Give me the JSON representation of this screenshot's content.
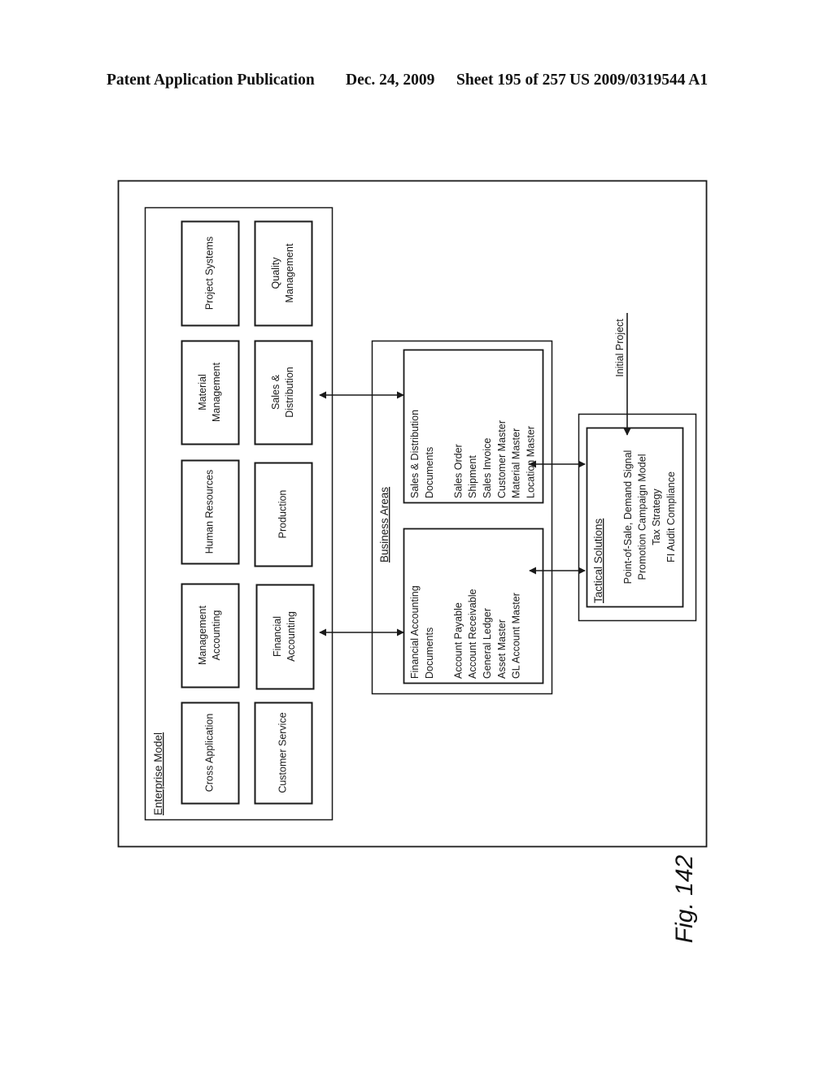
{
  "header": {
    "publication": "Patent Application Publication",
    "date": "Dec. 24, 2009",
    "sheet": "Sheet 195 of 257",
    "patent_number": "US 2009/0319544 A1"
  },
  "enterprise_model": {
    "title": "Enterprise Model",
    "modules": [
      {
        "lines": [
          "Project Systems"
        ]
      },
      {
        "lines": [
          "Quality",
          "Management"
        ]
      },
      {
        "lines": [
          "Material",
          "Management"
        ]
      },
      {
        "lines": [
          "Sales &",
          "Distribution"
        ]
      },
      {
        "lines": [
          "Human Resources"
        ]
      },
      {
        "lines": [
          "Production"
        ]
      },
      {
        "lines": [
          "Management",
          "Accounting"
        ]
      },
      {
        "lines": [
          "Financial",
          "Accounting"
        ]
      },
      {
        "lines": [
          "Cross Application"
        ]
      },
      {
        "lines": [
          "Customer Service"
        ]
      }
    ]
  },
  "business_areas": {
    "title": "Business Areas",
    "sales_distribution": {
      "lines": [
        "Sales & Distribution",
        "Documents",
        "",
        "Sales Order",
        "Shipment",
        "Sales Invoice",
        "Customer Master",
        "Material Master",
        "Location Master"
      ]
    },
    "financial_accounting": {
      "lines": [
        "Financial Accounting",
        "Documents",
        "",
        "Account Payable",
        "Account Receivable",
        "General Ledger",
        "Asset Master",
        "GL Account Master"
      ]
    }
  },
  "tactical_solutions": {
    "title": "Tactical Solutions",
    "lines": [
      "Point-of-Sale, Demand Signal",
      "Promotion Campaign Model",
      "Tax Strategy",
      "FI Audit Compliance"
    ]
  },
  "initial_project_label": "Initial Project",
  "figure_label": "Fig. 142"
}
